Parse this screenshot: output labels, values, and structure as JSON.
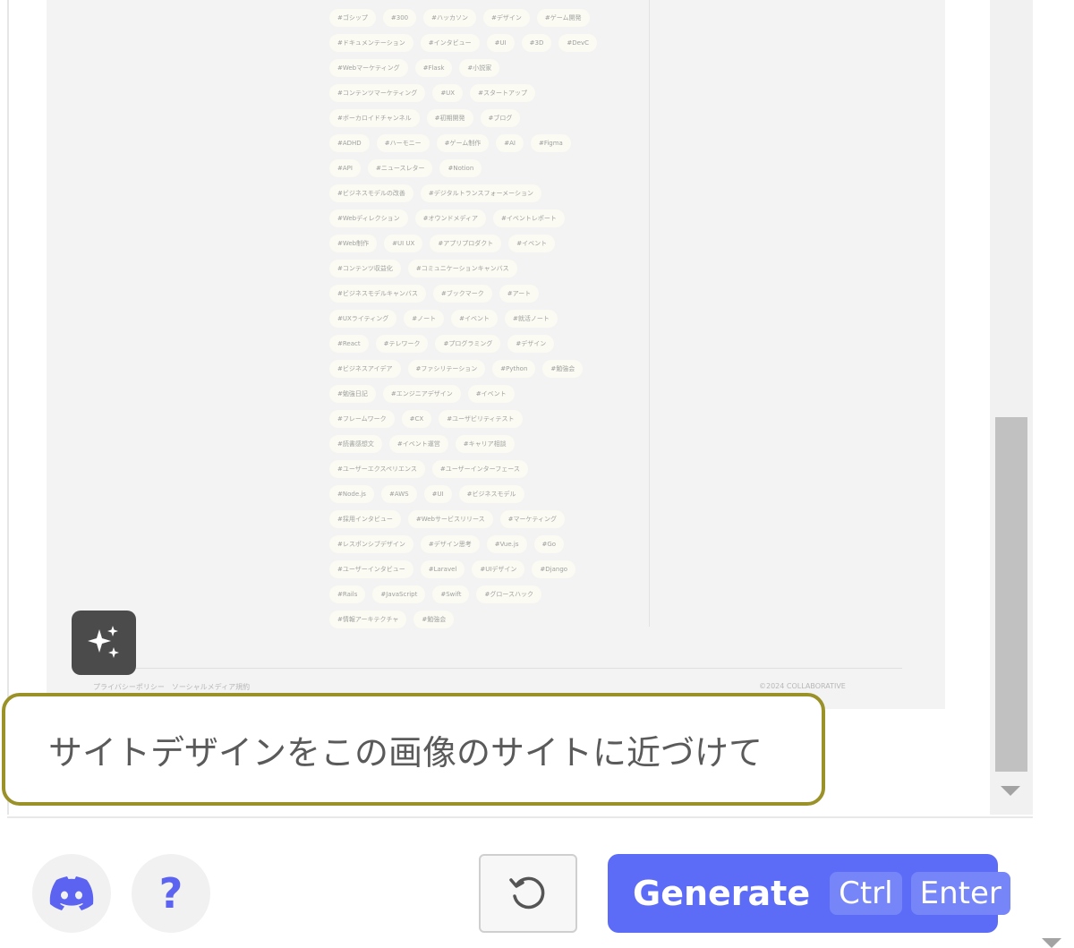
{
  "preview": {
    "tag_rows": [
      [
        "#ゴシップ",
        "#300",
        "#ハッカソン",
        "#デザイン",
        "#ゲーム開発"
      ],
      [
        "#ドキュメンテーション",
        "#インタビュー",
        "#UI",
        "#3D",
        "#DevC"
      ],
      [
        "#Webマーケティング",
        "#Flask",
        "#小説家"
      ],
      [
        "#コンテンツマーケティング",
        "#UX",
        "#スタートアップ"
      ],
      [
        "#ボーカロイドチャンネル",
        "#初期開発",
        "#ブログ"
      ],
      [
        "#ADHD",
        "#ハーモニー",
        "#ゲーム制作",
        "#AI",
        "#Figma"
      ],
      [
        "#API",
        "#ニュースレター",
        "#Notion"
      ],
      [
        "#ビジネスモデルの改善",
        "#デジタルトランスフォーメーション"
      ],
      [
        "#Webディレクション",
        "#オウンドメディア",
        "#イベントレポート"
      ],
      [
        "#Web制作",
        "#UI UX",
        "#アプリプロダクト",
        "#イベント"
      ],
      [
        "#コンテンツ収益化",
        "#コミュニケーションキャンバス"
      ],
      [
        "#ビジネスモデルキャンバス",
        "#ブックマーク",
        "#アート"
      ],
      [
        "#UXライティング",
        "#ノート",
        "#イベント",
        "#就活ノート"
      ],
      [
        "#React",
        "#テレワーク",
        "#プログラミング",
        "#デザイン"
      ],
      [
        "#ビジネスアイデア",
        "#ファシリテーション",
        "#Python",
        "#勉強会"
      ],
      [
        "#勉強日記",
        "#エンジニアデザイン",
        "#イベント"
      ],
      [
        "#フレームワーク",
        "#CX",
        "#ユーザビリティテスト"
      ],
      [
        "#読書感想文",
        "#イベント運営",
        "#キャリア相談"
      ],
      [
        "#ユーザーエクスペリエンス",
        "#ユーザーインターフェース"
      ],
      [
        "#Node.js",
        "#AWS",
        "#UI",
        "#ビジネスモデル"
      ],
      [
        "#採用インタビュー",
        "#Webサービスリリース",
        "#マーケティング"
      ],
      [
        "#レスポンシブデザイン",
        "#デザイン思考",
        "#Vue.js",
        "#Go"
      ],
      [
        "#ユーザーインタビュー",
        "#Laravel",
        "#UIデザイン",
        "#Django"
      ],
      [
        "#Rails",
        "#JavaScript",
        "#Swift",
        "#グロースハック"
      ],
      [
        "#情報アーキテクチャ",
        "#勉強会"
      ]
    ],
    "footer_left": "プライバシーポリシー　ソーシャルメディア規約",
    "footer_right": "©2024 COLLABORATIVE",
    "ai_icon": "sparkles-icon"
  },
  "chat": {
    "message": "サイトデザインをこの画像のサイトに近づけて"
  },
  "toolbar": {
    "discord_icon": "discord-icon",
    "help_label": "?",
    "reset_icon": "reset-icon",
    "generate_label": "Generate",
    "shortcut_key1": "Ctrl",
    "shortcut_key2": "Enter"
  },
  "colors": {
    "accent": "#5c6cf7",
    "bubble_border": "#9a9128",
    "ai_button": "#4b4b4b"
  }
}
